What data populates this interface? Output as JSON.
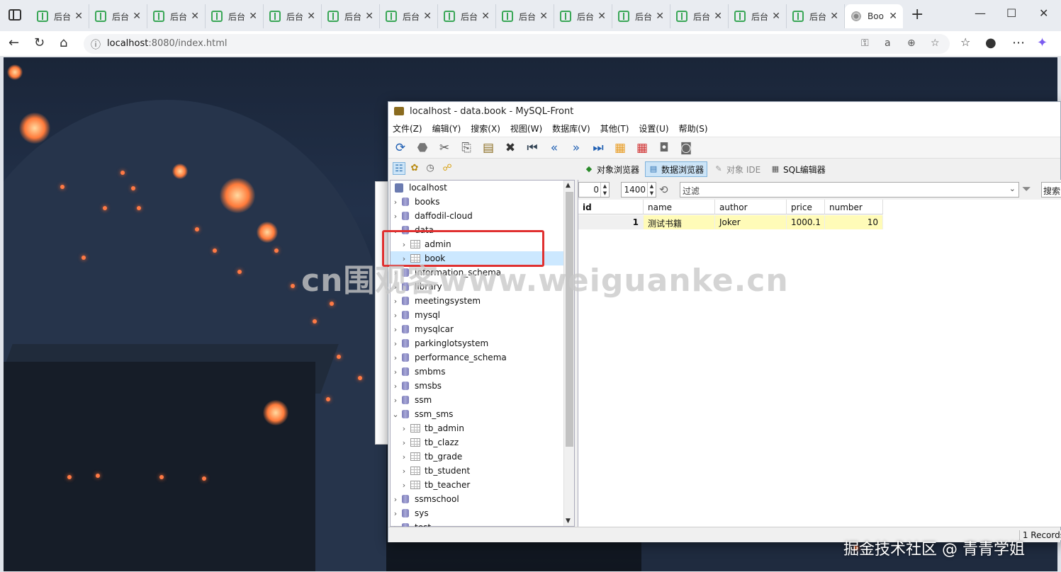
{
  "browser": {
    "tabs": [
      {
        "label": "后台"
      },
      {
        "label": "后台"
      },
      {
        "label": "后台"
      },
      {
        "label": "后台"
      },
      {
        "label": "后台"
      },
      {
        "label": "后台"
      },
      {
        "label": "后台"
      },
      {
        "label": "后台"
      },
      {
        "label": "后台"
      },
      {
        "label": "后台"
      },
      {
        "label": "后台"
      },
      {
        "label": "后台"
      },
      {
        "label": "后台"
      },
      {
        "label": "后台"
      },
      {
        "label": "Boo",
        "active": true
      }
    ],
    "url_host": "localhost",
    "url_rest": ":8080/index.html",
    "icons": {
      "back": "back-arrow-icon",
      "reload": "reload-icon",
      "home": "home-icon"
    }
  },
  "mysql_front": {
    "title": "localhost - data.book - MySQL-Front",
    "menu": [
      "文件(Z)",
      "编辑(Y)",
      "搜索(X)",
      "视图(W)",
      "数据库(V)",
      "其他(T)",
      "设置(U)",
      "帮助(S)"
    ],
    "view_tabs": {
      "object_browser": "对象浏览器",
      "data_browser": "数据浏览器",
      "object_ide": "对象 IDE",
      "sql_editor": "SQL编辑器"
    },
    "tree": {
      "server": "localhost",
      "items": [
        {
          "label": "books",
          "type": "db",
          "chevron": "›"
        },
        {
          "label": "daffodil-cloud",
          "type": "db",
          "chevron": "›"
        },
        {
          "label": "data",
          "type": "db",
          "chevron": "⌄"
        },
        {
          "label": "admin",
          "type": "table",
          "chevron": "›"
        },
        {
          "label": "book",
          "type": "table",
          "chevron": "›",
          "selected": true
        },
        {
          "label": "information_schema",
          "type": "db",
          "chevron": "›"
        },
        {
          "label": "library",
          "type": "db",
          "chevron": "›"
        },
        {
          "label": "meetingsystem",
          "type": "db",
          "chevron": "›"
        },
        {
          "label": "mysql",
          "type": "db",
          "chevron": "›"
        },
        {
          "label": "mysqlcar",
          "type": "db",
          "chevron": "›"
        },
        {
          "label": "parkinglotsystem",
          "type": "db",
          "chevron": "›"
        },
        {
          "label": "performance_schema",
          "type": "db",
          "chevron": "›"
        },
        {
          "label": "smbms",
          "type": "db",
          "chevron": "›"
        },
        {
          "label": "smsbs",
          "type": "db",
          "chevron": "›"
        },
        {
          "label": "ssm",
          "type": "db",
          "chevron": "›"
        },
        {
          "label": "ssm_sms",
          "type": "db",
          "chevron": "⌄"
        },
        {
          "label": "tb_admin",
          "type": "table",
          "chevron": "›"
        },
        {
          "label": "tb_clazz",
          "type": "table",
          "chevron": "›"
        },
        {
          "label": "tb_grade",
          "type": "table",
          "chevron": "›"
        },
        {
          "label": "tb_student",
          "type": "table",
          "chevron": "›"
        },
        {
          "label": "tb_teacher",
          "type": "table",
          "chevron": "›"
        },
        {
          "label": "ssmschool",
          "type": "db",
          "chevron": "›"
        },
        {
          "label": "sys",
          "type": "db",
          "chevron": "›"
        },
        {
          "label": "test",
          "type": "db",
          "chevron": "›"
        }
      ]
    },
    "data_view": {
      "offset": "0",
      "limit": "1400",
      "filter_placeholder": "过滤",
      "search_label": "搜索",
      "columns": [
        "id",
        "name",
        "author",
        "price",
        "number"
      ],
      "rows": [
        [
          "1",
          "测试书籍",
          "Joker",
          "1000.1",
          "10"
        ]
      ]
    },
    "status": "1 Records"
  },
  "overlay": {
    "watermark": "cn围观客www.weiguanke.cn",
    "signature": "掘金技术社区 @ 青青学姐"
  }
}
